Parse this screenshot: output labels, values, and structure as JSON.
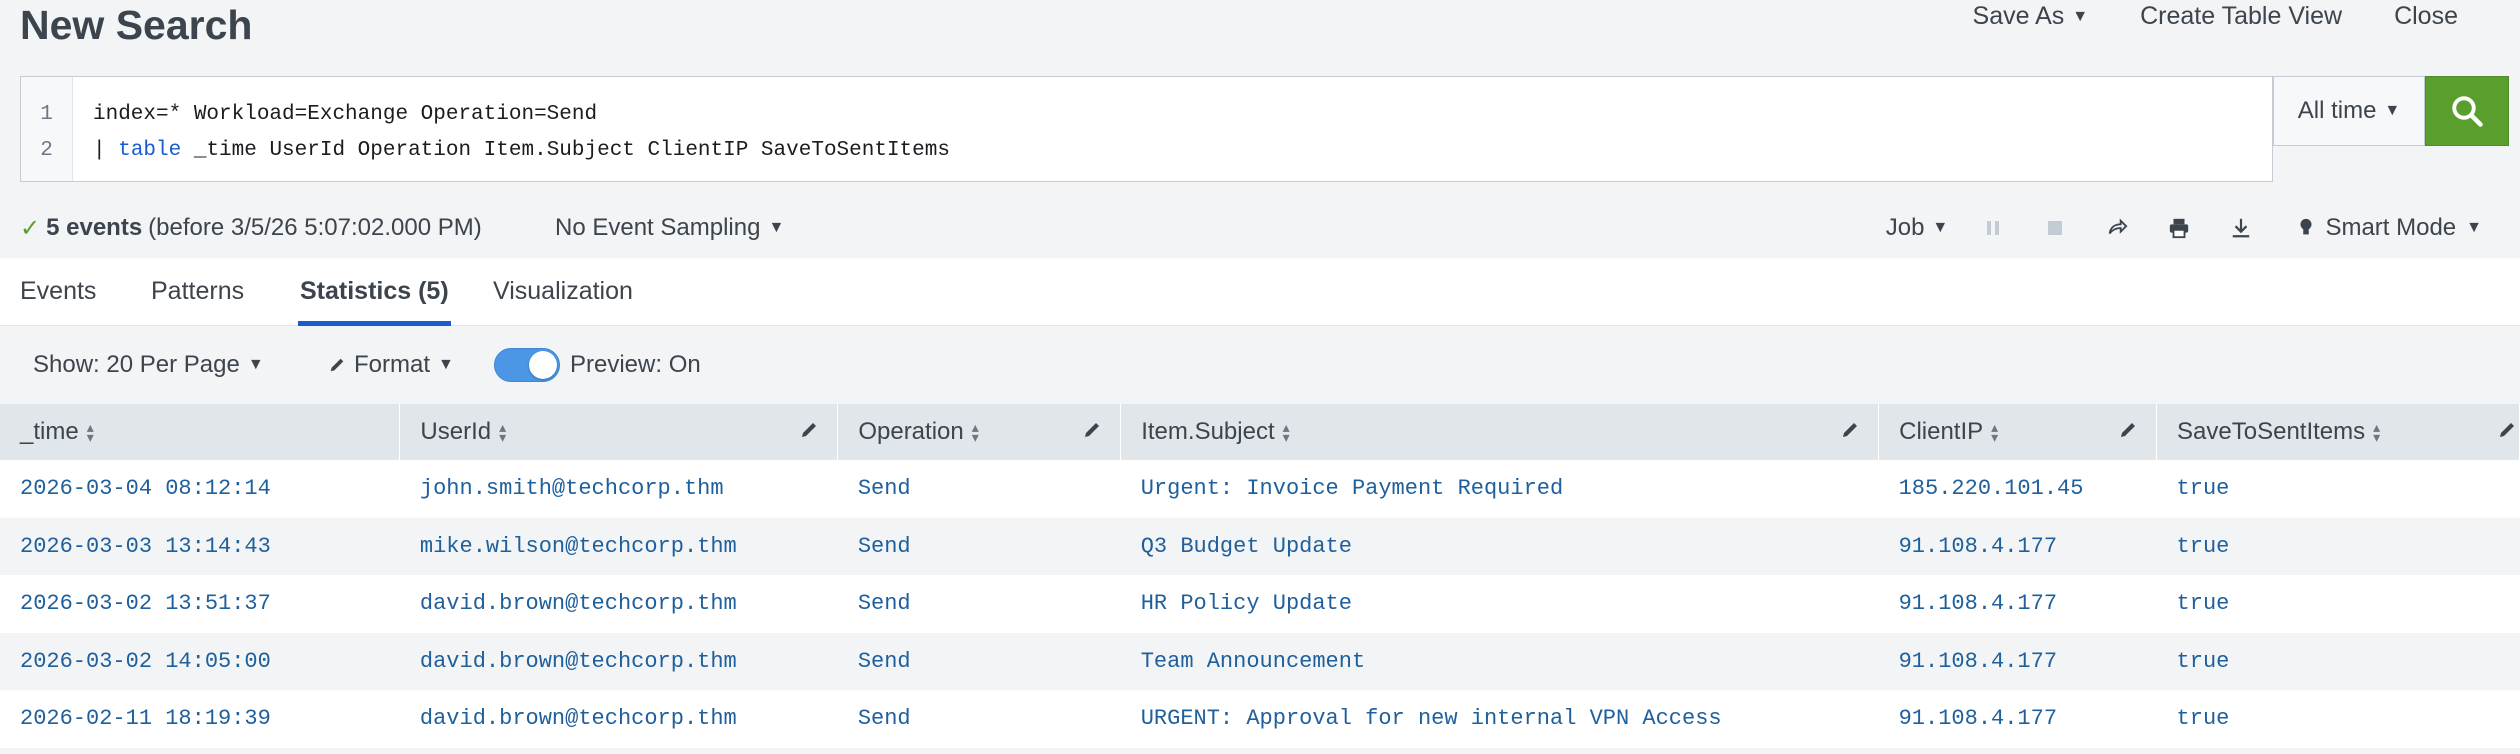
{
  "page": {
    "title": "New Search",
    "actions": {
      "save_as": "Save As",
      "create_table_view": "Create Table View",
      "close": "Close"
    }
  },
  "search": {
    "line_numbers": [
      "1",
      "2"
    ],
    "line1": "index=* Workload=Exchange Operation=Send",
    "line2_pipe": "| ",
    "line2_keyword": "table",
    "line2_rest": " _time UserId Operation Item.Subject ClientIP SaveToSentItems",
    "time_range": "All time"
  },
  "status": {
    "count": "5 events",
    "before": "(before 3/5/26 5:07:02.000 PM)",
    "sampling": "No Event Sampling",
    "job": "Job",
    "mode": "Smart Mode"
  },
  "tabs": [
    {
      "label": "Events"
    },
    {
      "label": "Patterns"
    },
    {
      "label": "Statistics (5)"
    },
    {
      "label": "Visualization"
    }
  ],
  "controls": {
    "show": "Show: 20 Per Page",
    "format": "Format",
    "preview": "Preview: On"
  },
  "table": {
    "columns": [
      "_time",
      "UserId",
      "Operation",
      "Item.Subject",
      "ClientIP",
      "SaveToSentItems"
    ],
    "rows": [
      [
        "2026-03-04 08:12:14",
        "john.smith@techcorp.thm",
        "Send",
        "Urgent: Invoice Payment Required",
        "185.220.101.45",
        "true"
      ],
      [
        "2026-03-03 13:14:43",
        "mike.wilson@techcorp.thm",
        "Send",
        "Q3 Budget Update",
        "91.108.4.177",
        "true"
      ],
      [
        "2026-03-02 13:51:37",
        "david.brown@techcorp.thm",
        "Send",
        "HR Policy Update",
        "91.108.4.177",
        "true"
      ],
      [
        "2026-03-02 14:05:00",
        "david.brown@techcorp.thm",
        "Send",
        "Team Announcement",
        "91.108.4.177",
        "true"
      ],
      [
        "2026-02-11 18:19:39",
        "david.brown@techcorp.thm",
        "Send",
        "URGENT: Approval for new internal VPN Access",
        "91.108.4.177",
        "true"
      ]
    ]
  },
  "colors": {
    "accent": "#1a5bcf",
    "search_button": "#5a9f2d",
    "link_text": "#1e5f9c",
    "toggle_on": "#4b97e6"
  }
}
